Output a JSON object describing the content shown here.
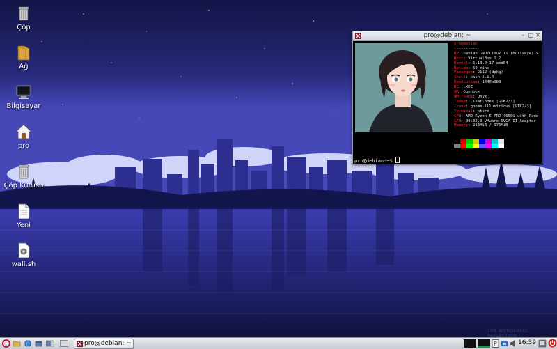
{
  "desktop": {
    "icons": [
      {
        "label": "Çöp"
      },
      {
        "label": "Ağ"
      },
      {
        "label": "Bilgisayar"
      },
      {
        "label": "pro"
      },
      {
        "label": "Çöp Kutusu"
      },
      {
        "label": "Yeni"
      },
      {
        "label": "wall.sh"
      }
    ]
  },
  "terminal": {
    "title": "pro@debian: ~",
    "neofetch": {
      "header": "pro@debian",
      "separator": "----------",
      "rows": [
        {
          "key": "OS",
          "value": "Debian GNU/Linux 11 (bullseye) x"
        },
        {
          "key": "Host",
          "value": "VirtualBox 1.2"
        },
        {
          "key": "Kernel",
          "value": "5.10.0-17-amd64"
        },
        {
          "key": "Uptime",
          "value": "59 mins"
        },
        {
          "key": "Packages",
          "value": "2112 (dpkg)"
        },
        {
          "key": "Shell",
          "value": "bash 5.1.4"
        },
        {
          "key": "Resolution",
          "value": "1440x900"
        },
        {
          "key": "DE",
          "value": "LXDE"
        },
        {
          "key": "WM",
          "value": "Openbox"
        },
        {
          "key": "WM Theme",
          "value": "Onyx"
        },
        {
          "key": "Theme",
          "value": "Clearlooks [GTK2/3]"
        },
        {
          "key": "Icons",
          "value": "gnome-illustrious [GTK2/3]"
        },
        {
          "key": "Terminal",
          "value": "xterm"
        },
        {
          "key": "CPU",
          "value": "AMD Ryzen 5 PRO 4650G with Rade"
        },
        {
          "key": "GPU",
          "value": "00:02.0 VMware SVGA II Adapter"
        },
        {
          "key": "Memory",
          "value": "283MiB / 976MiB"
        }
      ],
      "colors_row1": [
        "#000000",
        "#cd0000",
        "#00cd00",
        "#cdcd00",
        "#0000ee",
        "#cd00cd",
        "#00cdcd",
        "#e5e5e5"
      ],
      "colors_row2": [
        "#7f7f7f",
        "#ff0000",
        "#00ff00",
        "#ffff00",
        "#5c5cff",
        "#ff00ff",
        "#00ffff",
        "#ffffff"
      ]
    },
    "prompt": "pro@debian:~$ "
  },
  "taskbar": {
    "task_label": "pro@debian: ~",
    "clock": "16:39"
  },
  "wallpaper_credit": "THE WONDERFUL REFLECTION"
}
